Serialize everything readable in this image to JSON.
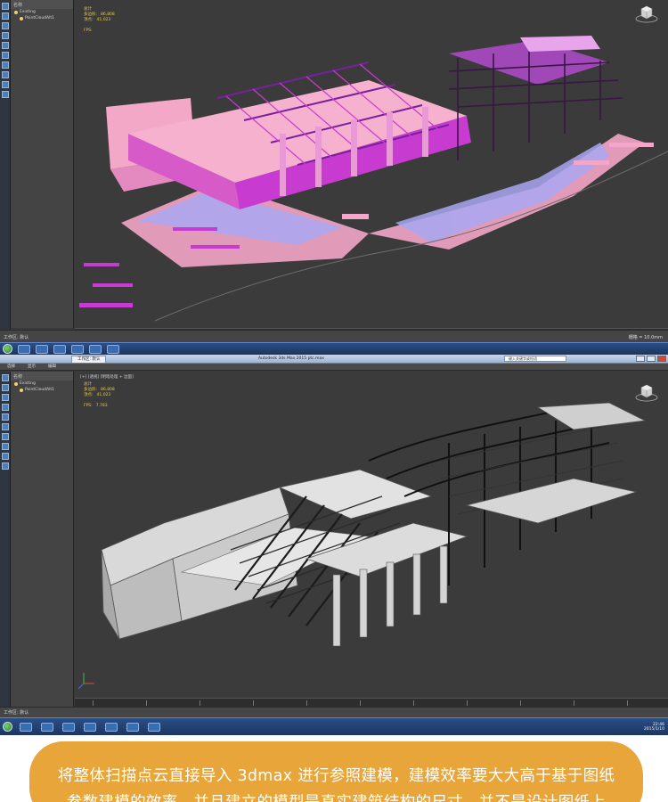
{
  "top_window": {
    "explorer_header": [
      "名称"
    ],
    "tree": [
      {
        "label": "Existing"
      },
      {
        "label": "PointCloudAlt1"
      }
    ],
    "stats": [
      {
        "name": "总计",
        "value": ""
      },
      {
        "name": "多边形:",
        "value": "86,808"
      },
      {
        "name": "顶点:",
        "value": "41,023"
      },
      {
        "name": "FPS:",
        "value": ""
      }
    ],
    "status_left": "工作区: 默认",
    "status_right": "栅格 = 10.0mm"
  },
  "bottom_window": {
    "title": "Autodesk 3ds Max 2015   ptc.max",
    "window_tab": "工作区: 默认",
    "search_placeholder": "键入关键字或短语",
    "menu": [
      "选择",
      "显示",
      "编辑"
    ],
    "viewport_label": "[+] [透视] [明暗处理 + 边面]",
    "explorer_header": [
      "名称"
    ],
    "tree": [
      {
        "label": "Existing"
      },
      {
        "label": "PointCloudAlt1"
      }
    ],
    "stats": [
      {
        "name": "总计",
        "value": ""
      },
      {
        "name": "多边形:",
        "value": "86,808"
      },
      {
        "name": "顶点:",
        "value": "41,023"
      },
      {
        "name": "FPS:",
        "value": "7.783"
      }
    ],
    "status_left": "工作区: 默认",
    "tray_time": "22:46",
    "tray_date": "2015/1/10"
  },
  "caption": {
    "text": "将整体扫描点云直接导入 3dmax 进行参照建模，建模效率要大大高于基于图纸参数建模的效率，并且建立的模型是真实建筑结构的尺寸，并不是设计图纸上"
  },
  "colors": {
    "caption_bg": "#e7a53a",
    "pointcloud_pink": "#f4a6c8",
    "pointcloud_magenta": "#c83bd1",
    "pointcloud_lavender": "#a9a7f2",
    "model_gray": "#c8c8c8",
    "viewport_bg": "#3b3b3b"
  }
}
